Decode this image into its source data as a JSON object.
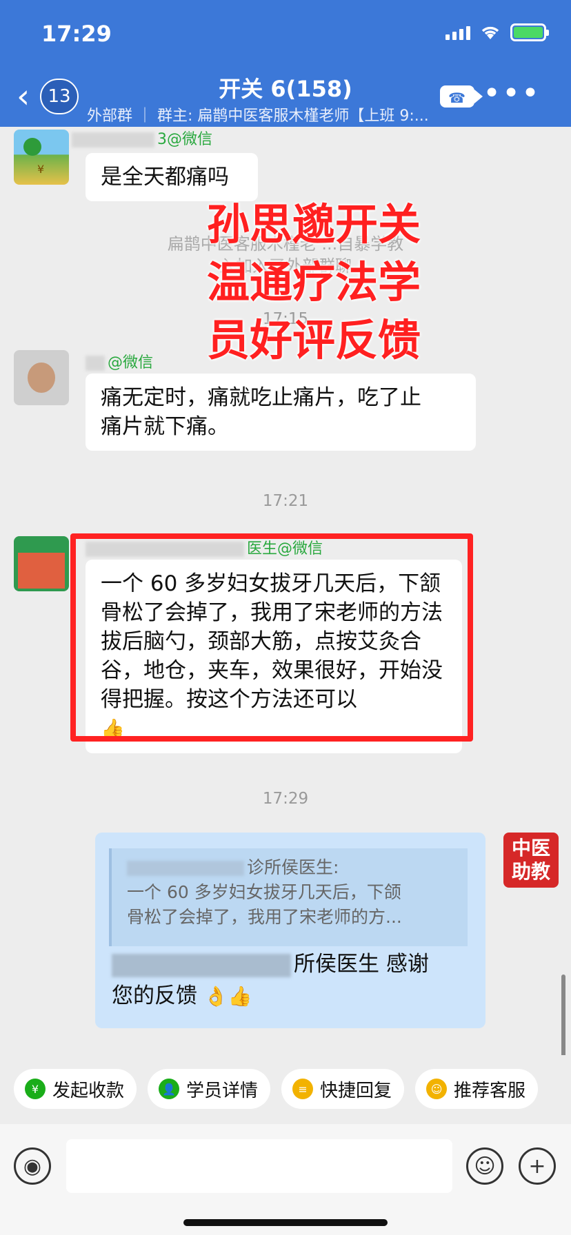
{
  "status_bar": {
    "time": "17:29"
  },
  "nav": {
    "back_glyph": "‹",
    "unread_count": "13",
    "title": "开关 6(158)",
    "subtitle": "外部群 ｜ 群主: 扁鹊中医客服木槿老师【上班 9:...",
    "video_icon": "video-call-icon",
    "more_glyph": "•••"
  },
  "messages": [
    {
      "sender_suffix": "3@微信",
      "text": "是全天都痛吗"
    },
    {
      "sender_suffix": "@微信",
      "text_line1": "痛无定时，痛就吃止痛片，吃了止",
      "text_line2": "痛片就下痛。"
    },
    {
      "sender_suffix": "医生@微信",
      "text": "一个 60 多岁妇女拔牙几天后，下颔骨松了会掉了，我用了宋老师的方法拔后脑勺，颈部大筋，点按艾灸合谷，地仓，夹车，效果很好，开始没得把握。按这个方法还可以",
      "emoji": "👍"
    }
  ],
  "system_msg": {
    "line1": "扁鹊中医客服木槿老       ...自暴学教",
    "line2": "                  入加入了外部群聊"
  },
  "timestamps": {
    "t1": "17:15",
    "t2": "17:21",
    "t3": "17:29"
  },
  "overlay_text": {
    "line1": "孙思邈开关",
    "line2": "温通疗法学",
    "line3": "员好评反馈"
  },
  "reply": {
    "quote_name": "诊所侯医生:",
    "quote_line1": "一个 60 多岁妇女拔牙几天后，下颌",
    "quote_line2": "骨松了会掉了，我用了宋老师的方...",
    "text_visible": "所侯医生 感谢",
    "text_line2": "您的反馈",
    "emojis": "👌👍",
    "avatar_text_line1": "中医",
    "avatar_text_line2": "助教"
  },
  "quick_actions": [
    {
      "label": "发起收款",
      "icon": "payment-shield-icon",
      "color": "#1aad19",
      "glyph": "¥"
    },
    {
      "label": "学员详情",
      "icon": "student-profile-icon",
      "color": "#1aad19",
      "glyph": "👤"
    },
    {
      "label": "快捷回复",
      "icon": "quick-reply-icon",
      "color": "#f2b200",
      "glyph": "≡"
    },
    {
      "label": "推荐客服",
      "icon": "recommend-service-icon",
      "color": "#f2b200",
      "glyph": "☺"
    }
  ],
  "input_bar": {
    "voice_glyph": "◉",
    "emoji_glyph": "☺",
    "plus_glyph": "+"
  }
}
